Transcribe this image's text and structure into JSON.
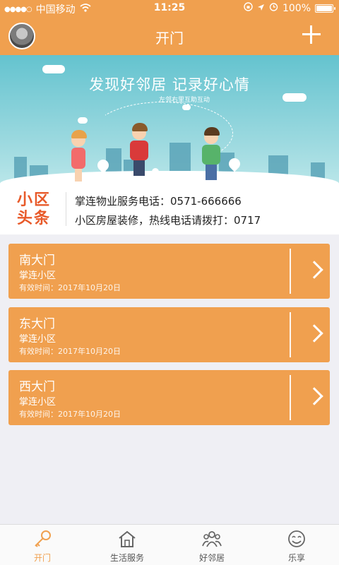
{
  "status": {
    "carrier": "中国移动",
    "time": "11:25",
    "battery": "100%",
    "battery_level": 1.0
  },
  "header": {
    "title": "开门"
  },
  "banner": {
    "headline": "发现好邻居  记录好心情",
    "subline": "左邻右里互助互动"
  },
  "news": {
    "badge_line1": "小区",
    "badge_line2": "头条",
    "items": [
      "掌连物业服务电话：0571-666666",
      "小区房屋装修，热线电话请拨打：0717"
    ]
  },
  "doors": [
    {
      "name": "南大门",
      "community": "掌连小区",
      "valid": "有效时间：2017年10月20日"
    },
    {
      "name": "东大门",
      "community": "掌连小区",
      "valid": "有效时间：2017年10月20日"
    },
    {
      "name": "西大门",
      "community": "掌连小区",
      "valid": "有效时间：2017年10月20日"
    }
  ],
  "tabs": [
    {
      "label": "开门",
      "icon": "key-icon",
      "active": true
    },
    {
      "label": "生活服务",
      "icon": "house-icon",
      "active": false
    },
    {
      "label": "好邻居",
      "icon": "people-icon",
      "active": false
    },
    {
      "label": "乐享",
      "icon": "smile-icon",
      "active": false
    }
  ],
  "colors": {
    "accent": "#f0a04f",
    "news_badge": "#e85a2a"
  }
}
